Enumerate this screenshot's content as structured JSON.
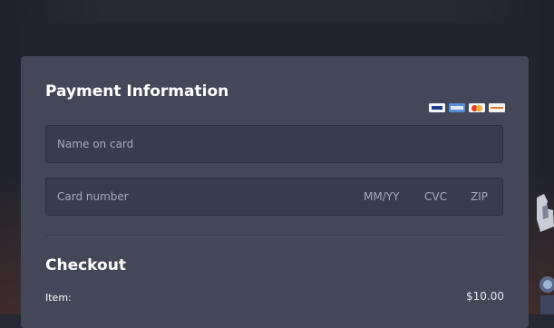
{
  "payment": {
    "title": "Payment Information",
    "card_brands": [
      "visa-icon",
      "amex-icon",
      "mastercard-icon",
      "discover-icon"
    ],
    "name_placeholder": "Name on card",
    "number_placeholder": "Card number",
    "expiry_placeholder": "MM/YY",
    "cvc_placeholder": "CVC",
    "zip_placeholder": "ZIP"
  },
  "checkout": {
    "title": "Checkout",
    "item_label": "Item:",
    "item_price": "$10.00"
  },
  "colors": {
    "background": "#262833",
    "panel": "#434758",
    "input": "#383c4c",
    "text": "#ffffff",
    "placeholder": "#a6aabd"
  }
}
